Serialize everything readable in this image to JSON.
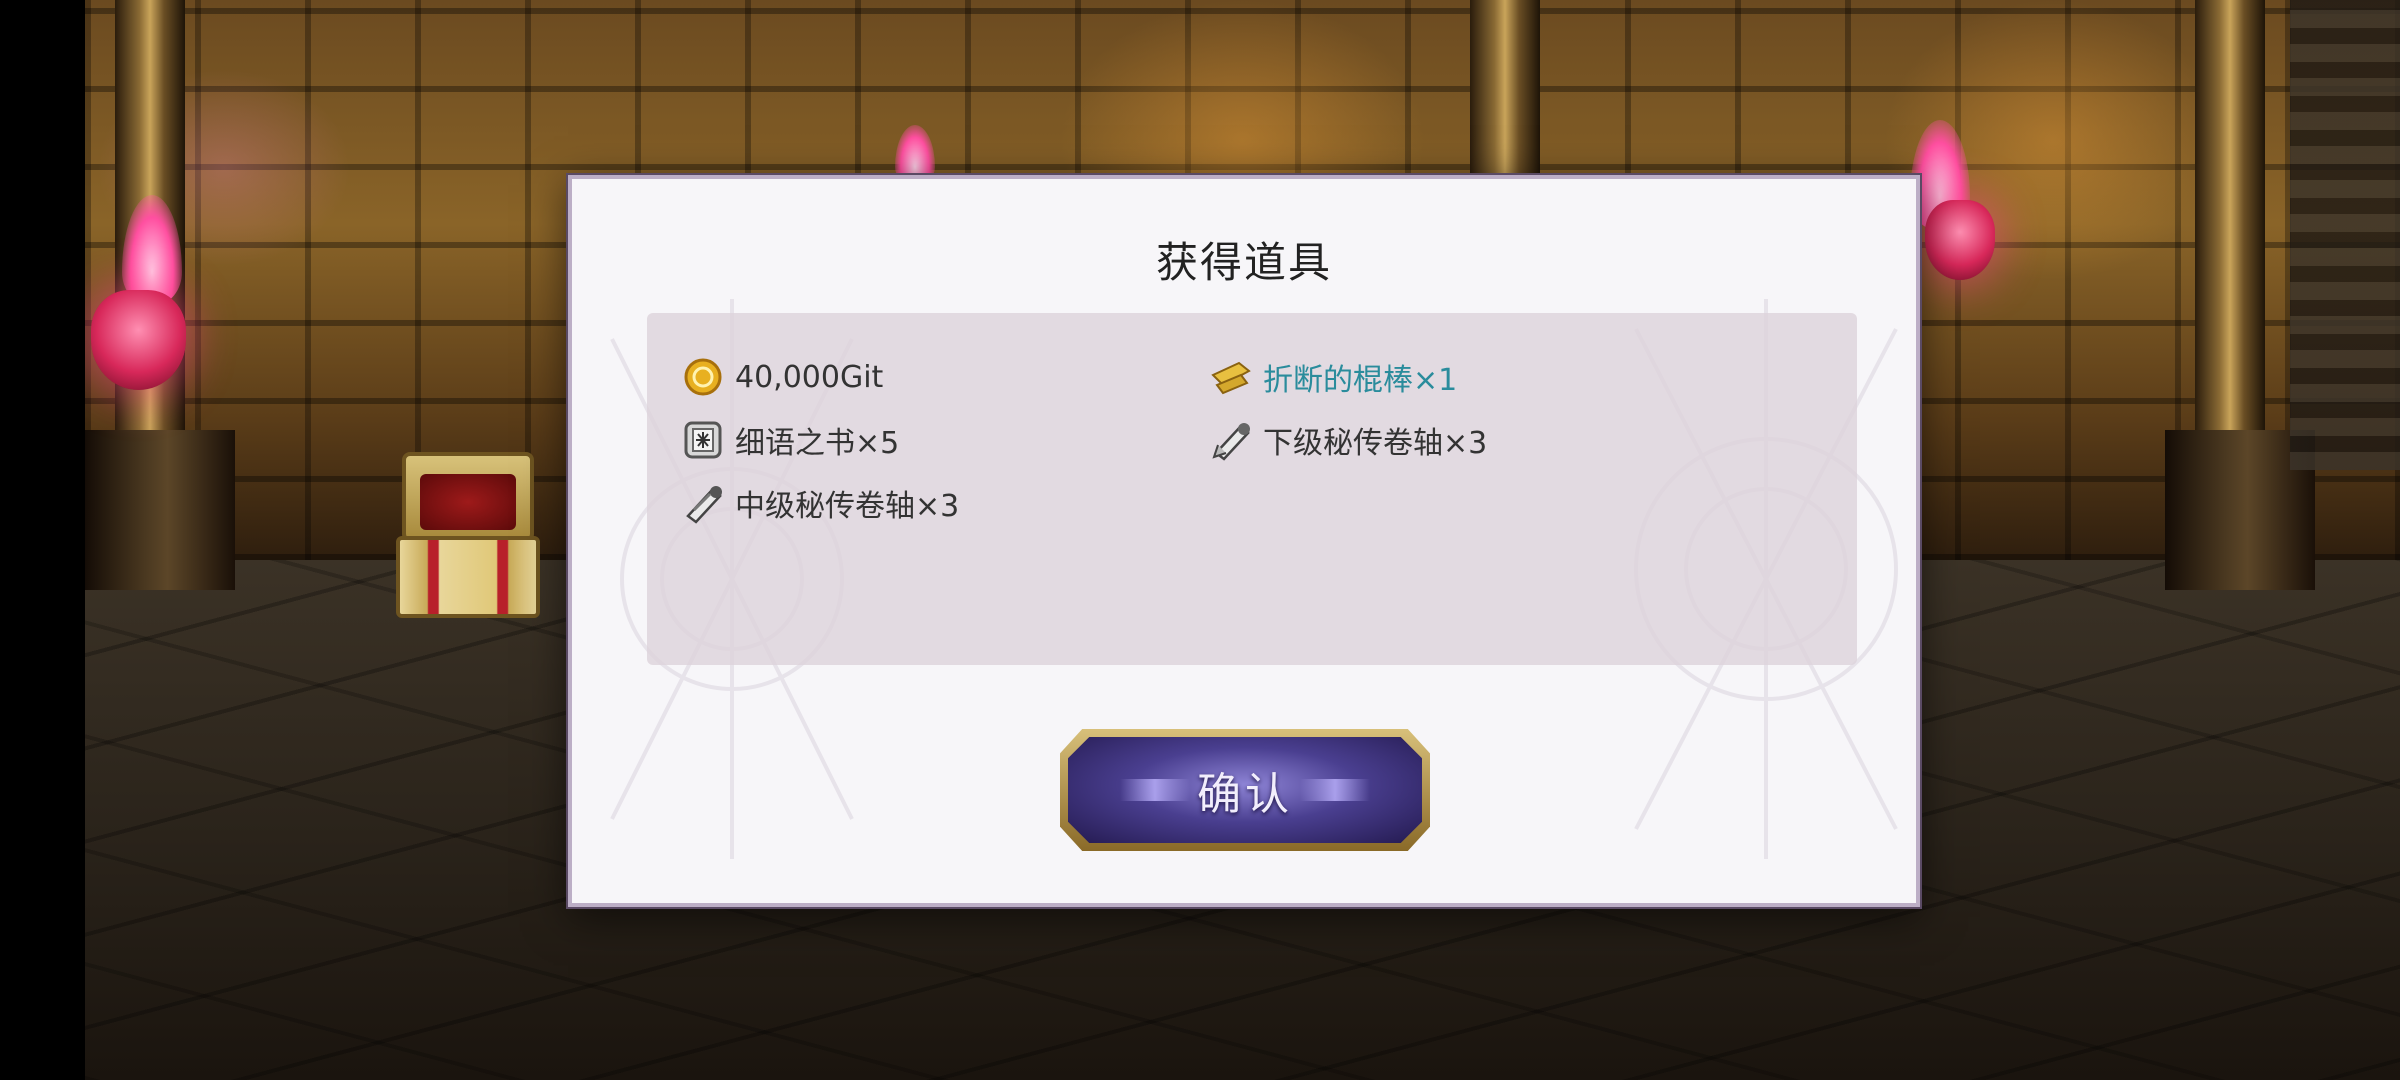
{
  "dialog": {
    "title": "获得道具",
    "confirm_label": "确认"
  },
  "items": [
    {
      "icon": "gold-coin-icon",
      "label": "40,000Git",
      "highlight": false
    },
    {
      "icon": "golden-stick-icon",
      "label": "折断的棍棒×1",
      "highlight": true
    },
    {
      "icon": "book-icon",
      "label": "细语之书×5",
      "highlight": false
    },
    {
      "icon": "scroll-icon",
      "label": "下级秘传卷轴×3",
      "highlight": false
    },
    {
      "icon": "scroll-icon",
      "label": "中级秘传卷轴×3",
      "highlight": false
    }
  ],
  "colors": {
    "highlight_text": "#2a8c9c",
    "normal_text": "#333333",
    "button_purple": "#4a3f90",
    "button_gold": "#d8c07a"
  }
}
